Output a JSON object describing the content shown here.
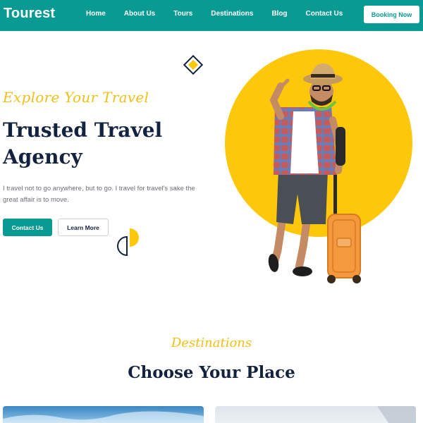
{
  "header": {
    "logo": "Tourest",
    "nav": [
      "Home",
      "About Us",
      "Tours",
      "Destinations",
      "Blog",
      "Contact Us"
    ],
    "cta_label": "Booking Now"
  },
  "hero": {
    "kicker": "Explore Your Travel",
    "title": "Trusted Travel Agency",
    "description": "I travel not to go anywhere, but to go. I travel for travel's sake the great affair is to move.",
    "primary_button": "Contact Us",
    "secondary_button": "Learn More"
  },
  "destinations": {
    "kicker": "Destinations",
    "title": "Choose Your Place"
  },
  "colors": {
    "brand": "#0a9a94",
    "accent": "#f0c019",
    "heading": "#13233f",
    "circle": "#fdc80c"
  }
}
